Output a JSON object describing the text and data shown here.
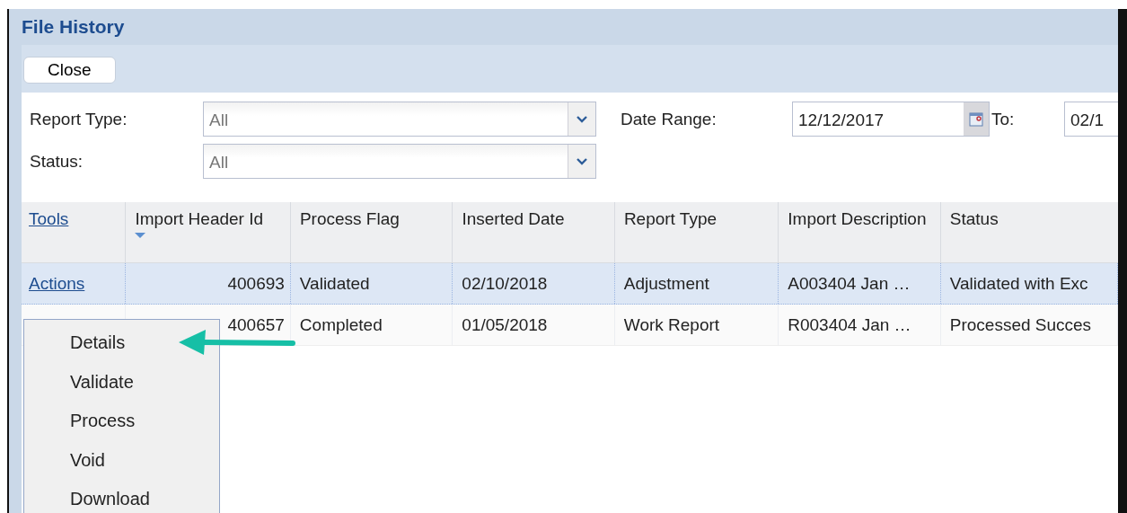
{
  "window": {
    "title": "File History"
  },
  "toolbar": {
    "buttons": [
      "Close"
    ]
  },
  "filters": {
    "report_type": {
      "label": "Report Type:",
      "value": "All"
    },
    "status": {
      "label": "Status:",
      "value": "All"
    },
    "date_range": {
      "label": "Date Range:",
      "from": "12/12/2017",
      "to_label": "To:",
      "to": "02/1"
    }
  },
  "table": {
    "columns": [
      {
        "label": "Tools",
        "kind": "link"
      },
      {
        "label": "Import Header Id",
        "sort_descending": true
      },
      {
        "label": "Process Flag"
      },
      {
        "label": "Inserted Date"
      },
      {
        "label": "Report Type"
      },
      {
        "label": "Import Description"
      },
      {
        "label": "Status"
      }
    ],
    "rows": [
      {
        "selected": true,
        "cells": [
          "Actions",
          "400693",
          "Validated",
          "02/10/2018",
          "Adjustment",
          "A003404 Jan …",
          "Validated with Exc"
        ]
      },
      {
        "selected": false,
        "cells": [
          "",
          "400657",
          "Completed",
          "01/05/2018",
          "Work Report",
          "R003404 Jan …",
          "Processed Succes"
        ]
      }
    ]
  },
  "context_menu": {
    "items": [
      "Details",
      "Validate",
      "Process",
      "Void",
      "Download"
    ]
  },
  "annotation": {
    "kind": "arrow",
    "color": "#16bfa6"
  }
}
